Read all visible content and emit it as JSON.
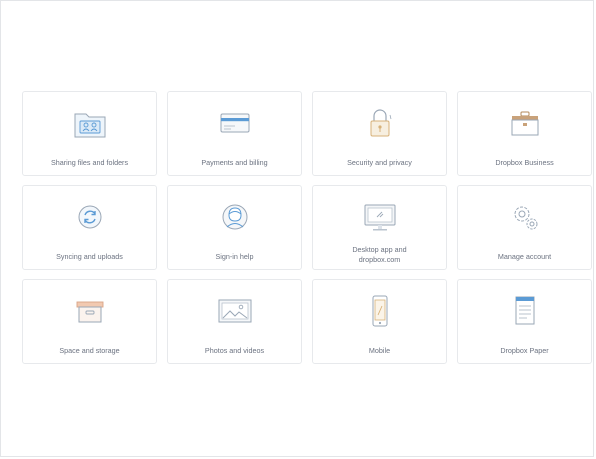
{
  "cards": [
    {
      "label": "Sharing files and folders",
      "icon": "shared-folder-icon"
    },
    {
      "label": "Payments and billing",
      "icon": "credit-card-icon"
    },
    {
      "label": "Security and privacy",
      "icon": "lock-icon"
    },
    {
      "label": "Dropbox Business",
      "icon": "briefcase-icon"
    },
    {
      "label": "Syncing and uploads",
      "icon": "sync-icon"
    },
    {
      "label": "Sign-in help",
      "icon": "user-icon"
    },
    {
      "label": "Desktop app and dropbox.com",
      "icon": "monitor-icon"
    },
    {
      "label": "Manage account",
      "icon": "gear-icon"
    },
    {
      "label": "Space and storage",
      "icon": "storage-box-icon"
    },
    {
      "label": "Photos and videos",
      "icon": "photo-icon"
    },
    {
      "label": "Mobile",
      "icon": "mobile-phone-icon"
    },
    {
      "label": "Dropbox Paper",
      "icon": "paper-document-icon"
    }
  ],
  "colors": {
    "icon_outline": "#9aa7b6",
    "accent_blue": "#5b9bd5",
    "accent_tan": "#d7b27a",
    "card_border": "#e7e9ec",
    "label_text": "#6b7280"
  }
}
